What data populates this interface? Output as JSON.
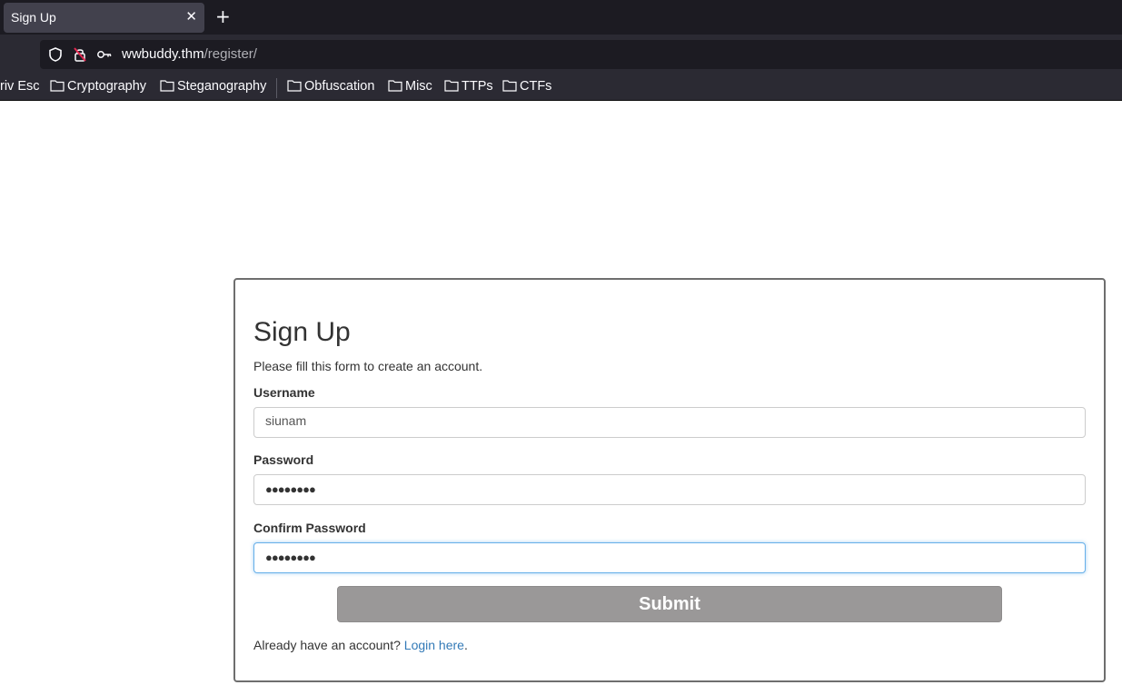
{
  "browser": {
    "tab_title": "Sign Up",
    "tab_close_glyph": "✕",
    "new_tab_glyph": "+",
    "url_host": "wwbuddy.thm",
    "url_path": "/register/",
    "icons": [
      "shield-icon",
      "lock-warning-icon",
      "key-icon"
    ],
    "bookmarks": [
      {
        "label": "riv Esc"
      },
      {
        "label": "Cryptography",
        "icon": "folder-icon"
      },
      {
        "label": "Steganography",
        "icon": "folder-icon"
      },
      {
        "label": "Obfuscation",
        "icon": "folder-icon"
      },
      {
        "label": "Misc",
        "icon": "folder-icon"
      },
      {
        "label": "TTPs",
        "icon": "folder-icon"
      },
      {
        "label": "CTFs",
        "icon": "folder-icon"
      }
    ]
  },
  "form": {
    "heading": "Sign Up",
    "subtext": "Please fill this form to create an account.",
    "username_label": "Username",
    "username_value": "siunam",
    "password_label": "Password",
    "password_value": "●●●●●●●●",
    "confirm_label": "Confirm Password",
    "confirm_value": "●●●●●●●●",
    "submit_label": "Submit",
    "footer_text": "Already have an account?",
    "login_link": "Login here",
    "footer_end": "."
  },
  "colors": {
    "tabbar_bg": "#1c1b22",
    "toolbar_bg": "#2b2a33",
    "submit_bg": "#9a9898",
    "link": "#337ab7",
    "focus_border": "#66afe9"
  }
}
